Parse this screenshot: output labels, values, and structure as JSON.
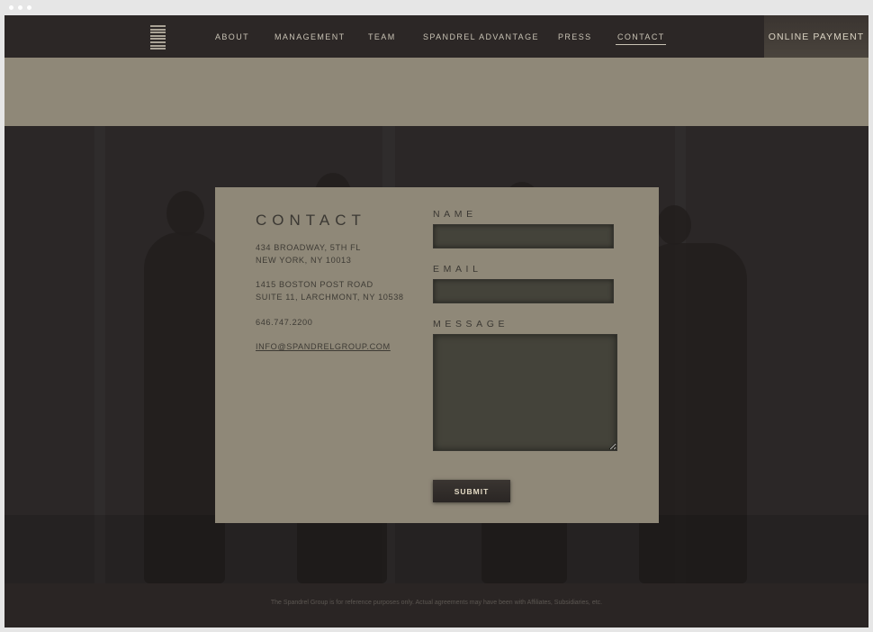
{
  "nav": {
    "items": [
      {
        "label": "ABOUT"
      },
      {
        "label": "MANAGEMENT"
      },
      {
        "label": "TEAM"
      },
      {
        "label": "SPANDREL ADVANTAGE"
      },
      {
        "label": "PRESS"
      },
      {
        "label": "CONTACT"
      }
    ],
    "active": "CONTACT",
    "payment_label": "ONLINE PAYMENT",
    "logo_icon": "stacked-bars-logo-icon"
  },
  "contact": {
    "title": "CONTACT",
    "address1_line1": "434 BROADWAY, 5TH FL",
    "address1_line2": "NEW YORK, NY 10013",
    "address2_line1": "1415 BOSTON POST ROAD",
    "address2_line2": "SUITE 11, LARCHMONT, NY 10538",
    "phone": "646.747.2200",
    "email": "INFO@SPANDRELGROUP.COM"
  },
  "form": {
    "name_label": "NAME",
    "name_value": "",
    "email_label": "EMAIL",
    "email_value": "",
    "message_label": "MESSAGE",
    "message_value": "",
    "submit_label": "SUBMIT"
  },
  "footer": {
    "text": "The Spandrel Group is for reference purposes only. Actual agreements may have been with Affiliates, Subsidiaries, etc."
  },
  "colors": {
    "nav_bg": "#2c2726",
    "panel_bg": "#8f8878",
    "field_bg": "#44433a",
    "text_dark": "#3b3833",
    "nav_text": "#c8c2b4"
  }
}
